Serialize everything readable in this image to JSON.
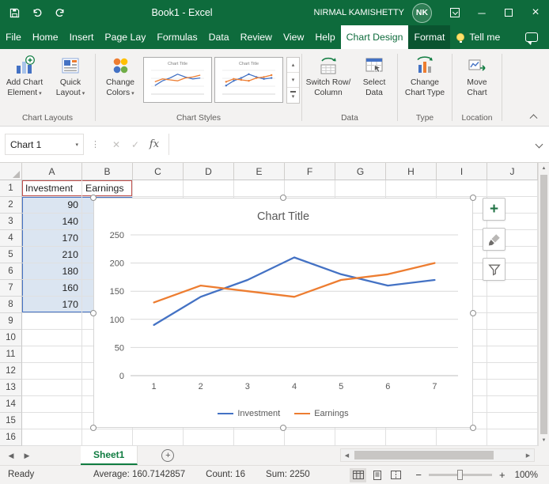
{
  "theme": {
    "green": "#0E6B3C",
    "green_dark": "#0A5430",
    "accent": "#107C41",
    "range_fill": "#DBE5F1",
    "range_border": "#4472C4",
    "series_name_border": "#C0504D"
  },
  "icons": {
    "caret_down": "▾",
    "gallery_up": "▴",
    "gallery_down": "▾",
    "gallery_more": "▾",
    "nav_left": "◀",
    "nav_right": "▶",
    "scroll_left": "◀",
    "scroll_right": "▶",
    "scroll_up": "▲",
    "scroll_down": "▼",
    "close": "×",
    "minimize": "─",
    "dots": "⋮",
    "cancel": "✕",
    "enter": "✓",
    "zoom_out": "−",
    "zoom_in": "+",
    "plus": "+"
  },
  "title_bar": {
    "title": "Book1  -  Excel",
    "user_name": "NIRMAL KAMISHETTY",
    "user_initials": "NK"
  },
  "tabs": [
    {
      "label": "File",
      "active": false
    },
    {
      "label": "Home",
      "active": false
    },
    {
      "label": "Insert",
      "active": false
    },
    {
      "label": "Page Lay",
      "active": false
    },
    {
      "label": "Formulas",
      "active": false
    },
    {
      "label": "Data",
      "active": false
    },
    {
      "label": "Review",
      "active": false
    },
    {
      "label": "View",
      "active": false
    },
    {
      "label": "Help",
      "active": false
    },
    {
      "label": "Chart Design",
      "active": true
    },
    {
      "label": "Format",
      "active": false,
      "contextual": true
    }
  ],
  "tell_me": "Tell me",
  "ribbon": {
    "group_labels": {
      "chart_layouts": "Chart Layouts",
      "chart_styles": "Chart Styles",
      "data": "Data",
      "type": "Type",
      "location": "Location"
    },
    "buttons": {
      "add_chart_element": {
        "l1": "Add Chart",
        "l2": "Element"
      },
      "quick_layout": {
        "l1": "Quick",
        "l2": "Layout"
      },
      "change_colors": {
        "l1": "Change",
        "l2": "Colors"
      },
      "switch_row_column": {
        "l1": "Switch Row/",
        "l2": "Column"
      },
      "select_data": {
        "l1": "Select",
        "l2": "Data"
      },
      "change_chart_type": {
        "l1": "Change",
        "l2": "Chart Type"
      },
      "move_chart": {
        "l1": "Move",
        "l2": "Chart"
      }
    }
  },
  "formula_bar": {
    "name_box": "Chart 1",
    "fx_label": "fx",
    "formula": ""
  },
  "grid": {
    "columns": [
      "A",
      "B",
      "C",
      "D",
      "E",
      "F",
      "G",
      "H",
      "I",
      "J"
    ],
    "rows": 16,
    "cells": {
      "A1": "Investment",
      "B1": "Earnings",
      "A2": "90",
      "A3": "140",
      "A4": "170",
      "A5": "210",
      "A6": "180",
      "A7": "160",
      "A8": "170"
    }
  },
  "chart_data": {
    "type": "line",
    "title": "Chart Title",
    "x": [
      1,
      2,
      3,
      4,
      5,
      6,
      7
    ],
    "series": [
      {
        "name": "Investment",
        "color": "#4472C4",
        "values": [
          90,
          140,
          170,
          210,
          180,
          160,
          170
        ]
      },
      {
        "name": "Earnings",
        "color": "#ED7D31",
        "values": [
          130,
          160,
          150,
          140,
          170,
          180,
          200
        ]
      }
    ],
    "ylim": [
      0,
      250
    ],
    "ytick": 50,
    "grid": true,
    "legend_position": "bottom"
  },
  "sheet_bar": {
    "active_sheet": "Sheet1"
  },
  "status_bar": {
    "mode": "Ready",
    "average": "Average: 160.7142857",
    "count": "Count: 16",
    "sum": "Sum: 2250",
    "zoom": "100%"
  }
}
